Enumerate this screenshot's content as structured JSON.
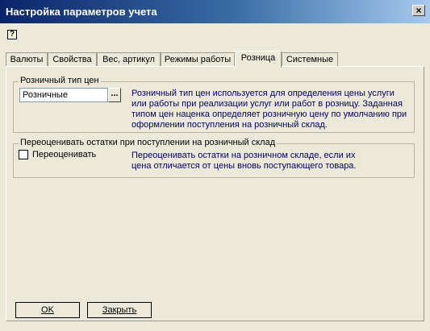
{
  "window": {
    "title": "Настройка параметров учета",
    "close_glyph": "×",
    "help_glyph": "?"
  },
  "tabs": [
    {
      "label": "Валюты"
    },
    {
      "label": "Свойства"
    },
    {
      "label": "Вес, артикул"
    },
    {
      "label": "Режимы работы"
    },
    {
      "label": "Розница"
    },
    {
      "label": "Системные"
    }
  ],
  "active_tab": "Розница",
  "retail_price": {
    "legend": "Розничный тип цен",
    "value": "Розничные",
    "button": "...",
    "description": "Розничный тип цен используется для определения цены услуги или работы при реализации услуг или работ в розницу. Заданная типом цен наценка определяет розничную цену по умолчанию при оформлении поступления на розничный склад."
  },
  "revalue": {
    "legend": "Переоценивать остатки при поступлении на розничный склад",
    "checkbox_label": "Переоценивать",
    "checked": false,
    "description": "Переоценивать остатки на розничном складе, если их цена отличается от цены вновь поступающего товара."
  },
  "buttons": {
    "ok": "OK",
    "close": "Закрыть"
  },
  "colors": {
    "title_bar": "#0a246a",
    "description_text": "#00006e",
    "window_bg": "#ece9d8"
  }
}
